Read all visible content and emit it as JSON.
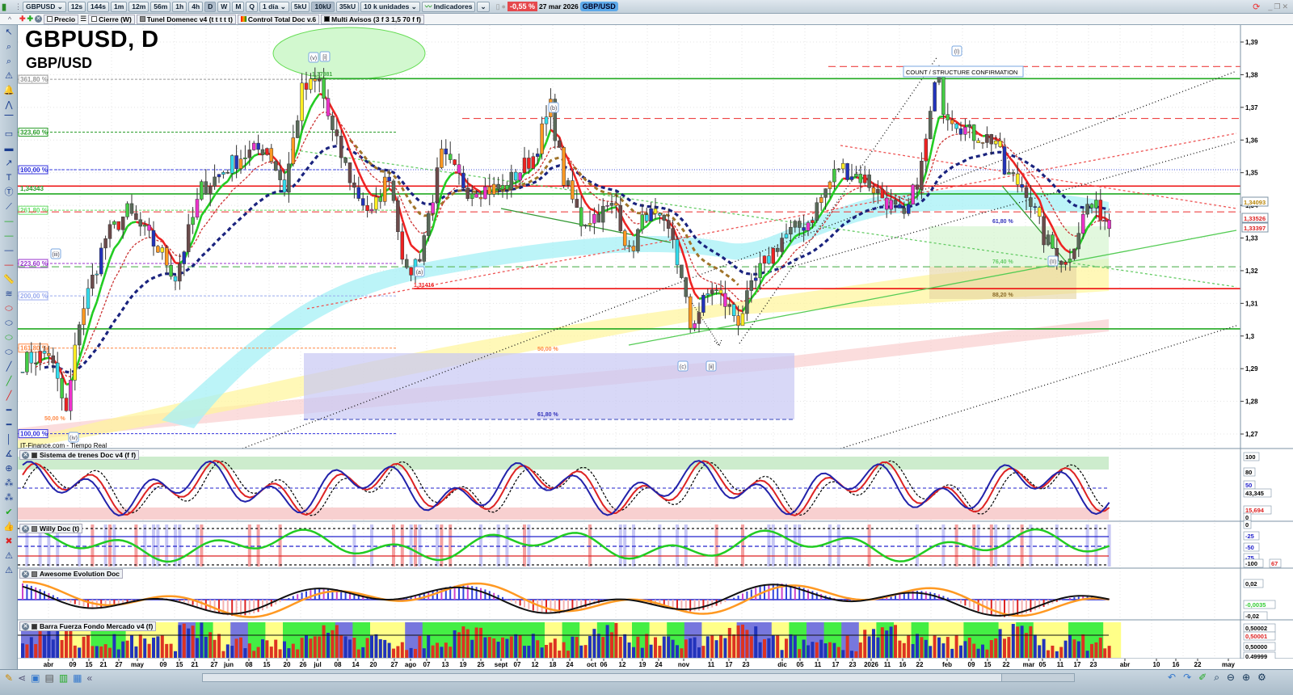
{
  "toolbar": {
    "symbol": "GBPUSD",
    "timeframes": [
      "12s",
      "144s",
      "1m",
      "12m",
      "56m",
      "1h",
      "4h",
      "D",
      "W",
      "M",
      "Q"
    ],
    "active_timeframe": "D",
    "period": "1 día",
    "units_buttons": [
      "5kU",
      "10kU",
      "35kU"
    ],
    "active_units": "10kU",
    "units_select": "10 k unidades",
    "indicators_label": "Indicadores",
    "change_pct": "-0,55 %",
    "date": "27 mar 2026",
    "pair_badge": "GBP/USD"
  },
  "legend_bar": {
    "items": [
      "Precio",
      "Cierre (W)",
      "Tunel Domenec v4 (t t t t t)",
      "Control Total Doc v.6",
      "Multi Avisos (3 f 3 1,5 70 f f)"
    ]
  },
  "chart": {
    "title": "GBPUSD, D",
    "subtitle": "GBP/USD",
    "source": "IT-Finance.com - Tiempo Real",
    "annotation": "COUNT / STRUCTURE CONFIRMATION",
    "wave_labels": [
      "(v)",
      "[i]",
      "(b)",
      "(a)",
      "(c)",
      "[ii]",
      "(iii)",
      "(iv)",
      "(I)",
      "(II)"
    ],
    "price_labels": {
      "high": "1,37881",
      "low": "1,31416"
    },
    "fib_left": [
      {
        "label": "361,80 %",
        "price": 1.3786,
        "color": "#999999"
      },
      {
        "label": "323,60 %",
        "price": 1.3624,
        "color": "#2a9d2a"
      },
      {
        "label": "100,00 %",
        "price": 1.3509,
        "color": "#3333dd"
      },
      {
        "label": "261,80 %",
        "price": 1.3385,
        "color": "#66dd66"
      },
      {
        "label": "223,60 %",
        "price": 1.3222,
        "color": "#9933cc"
      },
      {
        "label": "200,00 %",
        "price": 1.3123,
        "color": "#99aaee"
      },
      {
        "label": "161,80 %",
        "price": 1.2963,
        "color": "#ff8844"
      },
      {
        "label": "100,00 %",
        "price": 1.2701,
        "color": "#3333dd"
      }
    ],
    "level_label": "1,34343",
    "fib_inner": [
      "50,00 %",
      "50,00 %",
      "61,80 %",
      "61,80 %",
      "76,40 %",
      "88,20 %"
    ],
    "levels": [
      {
        "price": 1.3788,
        "color": "#22aa22",
        "style": "solid"
      },
      {
        "price": 1.3825,
        "color": "#ee4444",
        "style": "dashed"
      },
      {
        "price": 1.3666,
        "color": "#ee4444",
        "style": "dashed"
      },
      {
        "price": 1.3459,
        "color": "#ee1111",
        "style": "solid"
      },
      {
        "price": 1.3435,
        "color": "#22aa22",
        "style": "solid"
      },
      {
        "price": 1.338,
        "color": "#ee4444",
        "style": "dashed"
      },
      {
        "price": 1.3212,
        "color": "#66bb66",
        "style": "dashed"
      },
      {
        "price": 1.3145,
        "color": "#ee1111",
        "style": "solid"
      },
      {
        "price": 1.3022,
        "color": "#22aa22",
        "style": "solid"
      }
    ],
    "price_tags": [
      {
        "text": "1,34093",
        "color": "#b8860b"
      },
      {
        "text": "1,33526",
        "color": "#dd2222"
      },
      {
        "text": "1,33397",
        "color": "#dd2222"
      }
    ],
    "colors": {
      "up": "#5a6b5a",
      "accent_green": "#22cc22",
      "accent_red": "#ee2222",
      "slow_ma": "#1a237e",
      "brown_ma": "#a0742a"
    }
  },
  "chart_data": {
    "type": "candlestick",
    "title": "GBPUSD, D",
    "ylabel": "GBP/USD",
    "ylim": [
      1.265,
      1.395
    ],
    "y_ticks": [
      "1,39",
      "1,38",
      "1,37",
      "1,36",
      "1,35",
      "1,34",
      "1,33",
      "1,32",
      "1,31",
      "1,3",
      "1,29",
      "1,28",
      "1,27"
    ],
    "y_tick_values": [
      1.39,
      1.38,
      1.37,
      1.36,
      1.35,
      1.34,
      1.33,
      1.32,
      1.31,
      1.3,
      1.29,
      1.28,
      1.27
    ],
    "x_ticks": [
      "abr",
      "09",
      "15",
      "21",
      "27",
      "may",
      "09",
      "15",
      "21",
      "27",
      "jun",
      "08",
      "15",
      "20",
      "26",
      "jul",
      "08",
      "14",
      "20",
      "27",
      "ago",
      "07",
      "13",
      "19",
      "25",
      "sept",
      "07",
      "12",
      "18",
      "24",
      "oct",
      "06",
      "12",
      "19",
      "24",
      "nov",
      "11",
      "17",
      "23",
      "dic",
      "05",
      "11",
      "17",
      "23",
      "2026",
      "11",
      "16",
      "22",
      "feb",
      "09",
      "15",
      "22",
      "mar",
      "05",
      "11",
      "17",
      "23",
      "abr",
      "10",
      "16",
      "22",
      "may"
    ],
    "close_waypoints": [
      [
        0,
        1.292
      ],
      [
        6,
        1.295
      ],
      [
        10,
        1.276
      ],
      [
        13,
        1.305
      ],
      [
        19,
        1.33
      ],
      [
        24,
        1.338
      ],
      [
        32,
        1.325
      ],
      [
        35,
        1.318
      ],
      [
        41,
        1.345
      ],
      [
        50,
        1.355
      ],
      [
        56,
        1.358
      ],
      [
        60,
        1.345
      ],
      [
        64,
        1.375
      ],
      [
        68,
        1.378
      ],
      [
        71,
        1.362
      ],
      [
        76,
        1.345
      ],
      [
        80,
        1.337
      ],
      [
        84,
        1.35
      ],
      [
        88,
        1.318
      ],
      [
        91,
        1.325
      ],
      [
        96,
        1.355
      ],
      [
        102,
        1.345
      ],
      [
        110,
        1.345
      ],
      [
        117,
        1.355
      ],
      [
        121,
        1.37
      ],
      [
        124,
        1.348
      ],
      [
        128,
        1.335
      ],
      [
        136,
        1.34
      ],
      [
        139,
        1.325
      ],
      [
        143,
        1.338
      ],
      [
        149,
        1.33
      ],
      [
        153,
        1.303
      ],
      [
        158,
        1.315
      ],
      [
        164,
        1.305
      ],
      [
        169,
        1.32
      ],
      [
        174,
        1.33
      ],
      [
        180,
        1.335
      ],
      [
        187,
        1.352
      ],
      [
        193,
        1.348
      ],
      [
        199,
        1.34
      ],
      [
        202,
        1.335
      ],
      [
        206,
        1.352
      ],
      [
        210,
        1.383
      ],
      [
        211,
        1.37
      ],
      [
        217,
        1.362
      ],
      [
        223,
        1.36
      ],
      [
        225,
        1.35
      ],
      [
        230,
        1.345
      ],
      [
        234,
        1.33
      ],
      [
        239,
        1.322
      ],
      [
        244,
        1.34
      ],
      [
        247,
        1.338
      ],
      [
        249,
        1.334
      ]
    ]
  },
  "panes": [
    {
      "name": "Sistema de trenes Doc v4 (f f)",
      "axis": [
        "100",
        "80",
        "50",
        "43,345",
        "15,694",
        "0"
      ]
    },
    {
      "name": "Willy Doc (t)",
      "axis": [
        "0",
        "-25",
        "-50",
        "-75",
        "-100",
        "67"
      ]
    },
    {
      "name": "Awesome Evolution Doc",
      "axis": [
        "0,02",
        "-0,0035",
        "-0,02"
      ]
    },
    {
      "name": "Barra Fuerza Fondo Mercado v4 (f)",
      "axis": [
        "0,50002",
        "0,50001",
        "0,50000",
        "0,49999"
      ]
    }
  ]
}
